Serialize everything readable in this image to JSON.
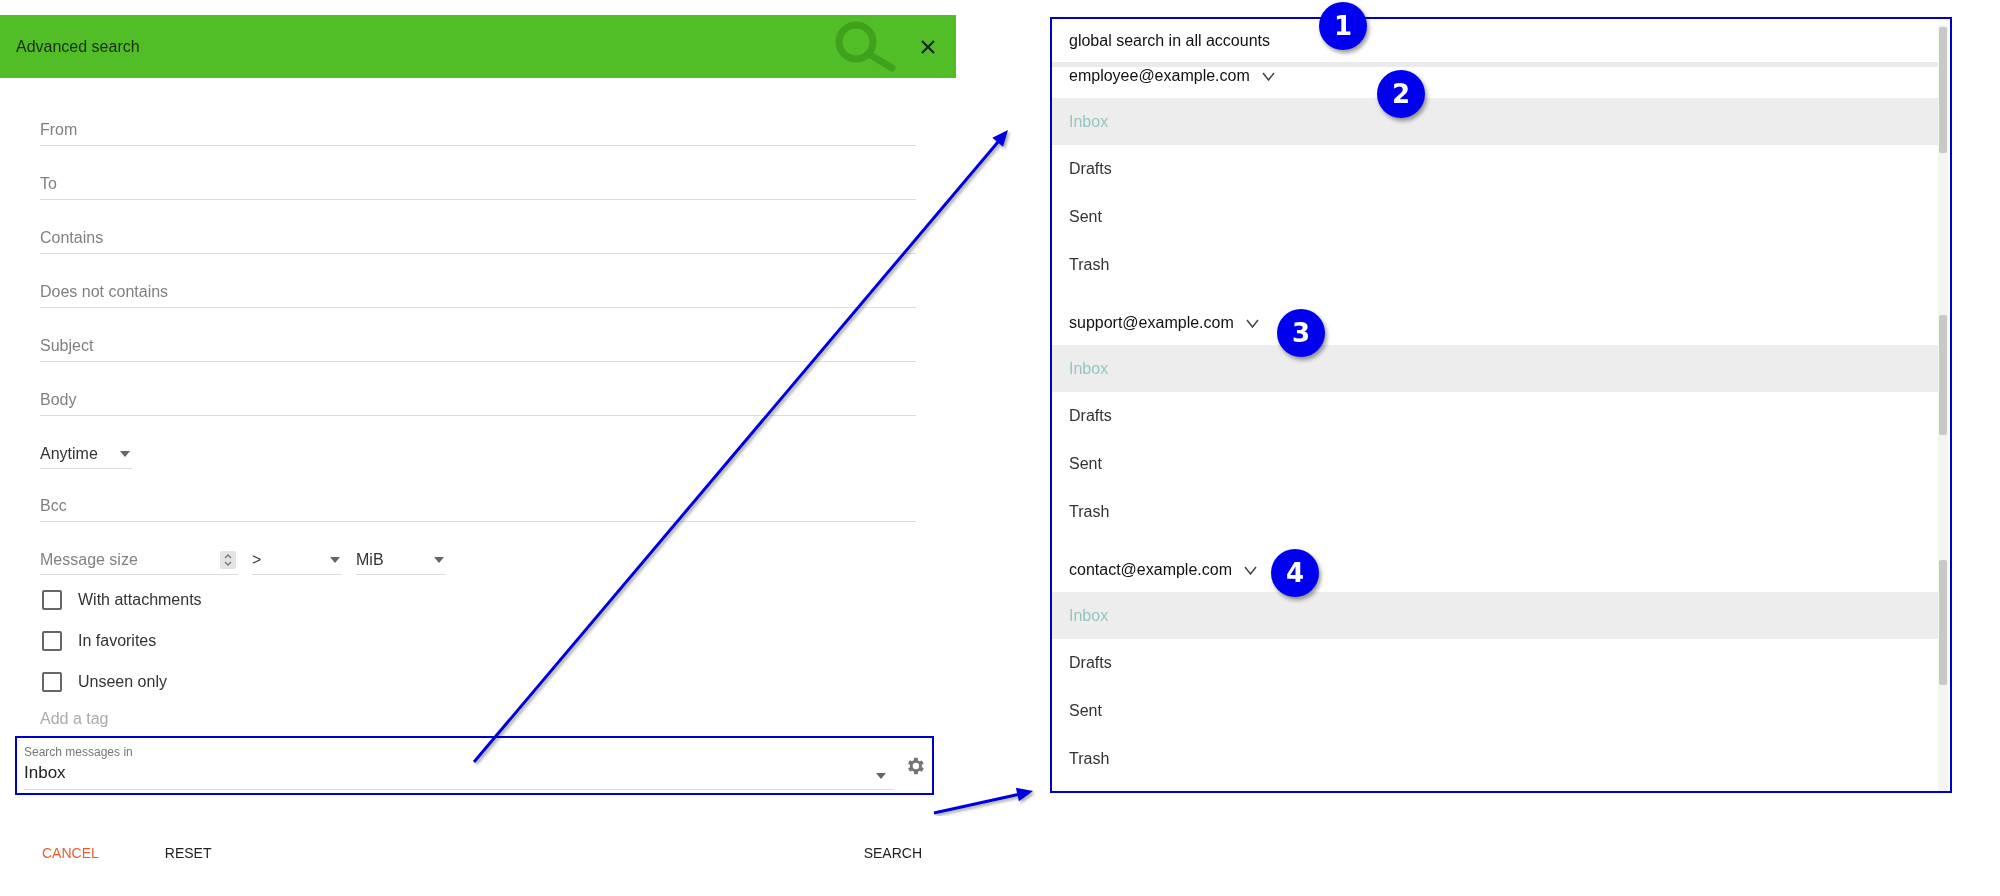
{
  "dialog": {
    "title": "Advanced search",
    "fields": [
      {
        "kind": "text",
        "placeholder": "From"
      },
      {
        "kind": "text",
        "placeholder": "To"
      },
      {
        "kind": "text",
        "placeholder": "Contains"
      },
      {
        "kind": "text",
        "placeholder": "Does not contains"
      },
      {
        "kind": "text",
        "placeholder": "Subject"
      },
      {
        "kind": "text",
        "placeholder": "Body"
      },
      {
        "kind": "select",
        "value": "Anytime"
      },
      {
        "kind": "text",
        "placeholder": "Bcc"
      }
    ],
    "size": {
      "placeholder": "Message size",
      "operator": ">",
      "unit": "MiB"
    },
    "checkboxes": [
      {
        "label": "With attachments",
        "checked": false
      },
      {
        "label": "In favorites",
        "checked": false
      },
      {
        "label": "Unseen only",
        "checked": false
      }
    ],
    "tag_field": {
      "placeholder": "Add a tag"
    },
    "search_in": {
      "label": "Search messages in",
      "value": "Inbox",
      "callout_highlighted": true
    },
    "buttons": [
      {
        "label": "CANCEL",
        "kind": "cancel"
      },
      {
        "label": "RESET",
        "kind": "plain"
      },
      {
        "label": "SEARCH",
        "kind": "primary"
      }
    ]
  },
  "folder_dropdown": {
    "global": {
      "label": "global search in all accounts",
      "callout": "1"
    },
    "accounts": [
      {
        "email": "employee@example.com",
        "callout": "2",
        "folders": [
          {
            "name": "Inbox",
            "selected": true
          },
          {
            "name": "Drafts",
            "selected": false
          },
          {
            "name": "Sent",
            "selected": false
          },
          {
            "name": "Trash",
            "selected": false
          }
        ]
      },
      {
        "email": "support@example.com",
        "callout": "3",
        "folders": [
          {
            "name": "Inbox",
            "selected": true
          },
          {
            "name": "Drafts",
            "selected": false
          },
          {
            "name": "Sent",
            "selected": false
          },
          {
            "name": "Trash",
            "selected": false
          }
        ]
      },
      {
        "email": "contact@example.com",
        "callout": "4",
        "folders": [
          {
            "name": "Inbox",
            "selected": true
          },
          {
            "name": "Drafts",
            "selected": false
          },
          {
            "name": "Sent",
            "selected": false
          },
          {
            "name": "Trash",
            "selected": false
          }
        ]
      }
    ]
  }
}
